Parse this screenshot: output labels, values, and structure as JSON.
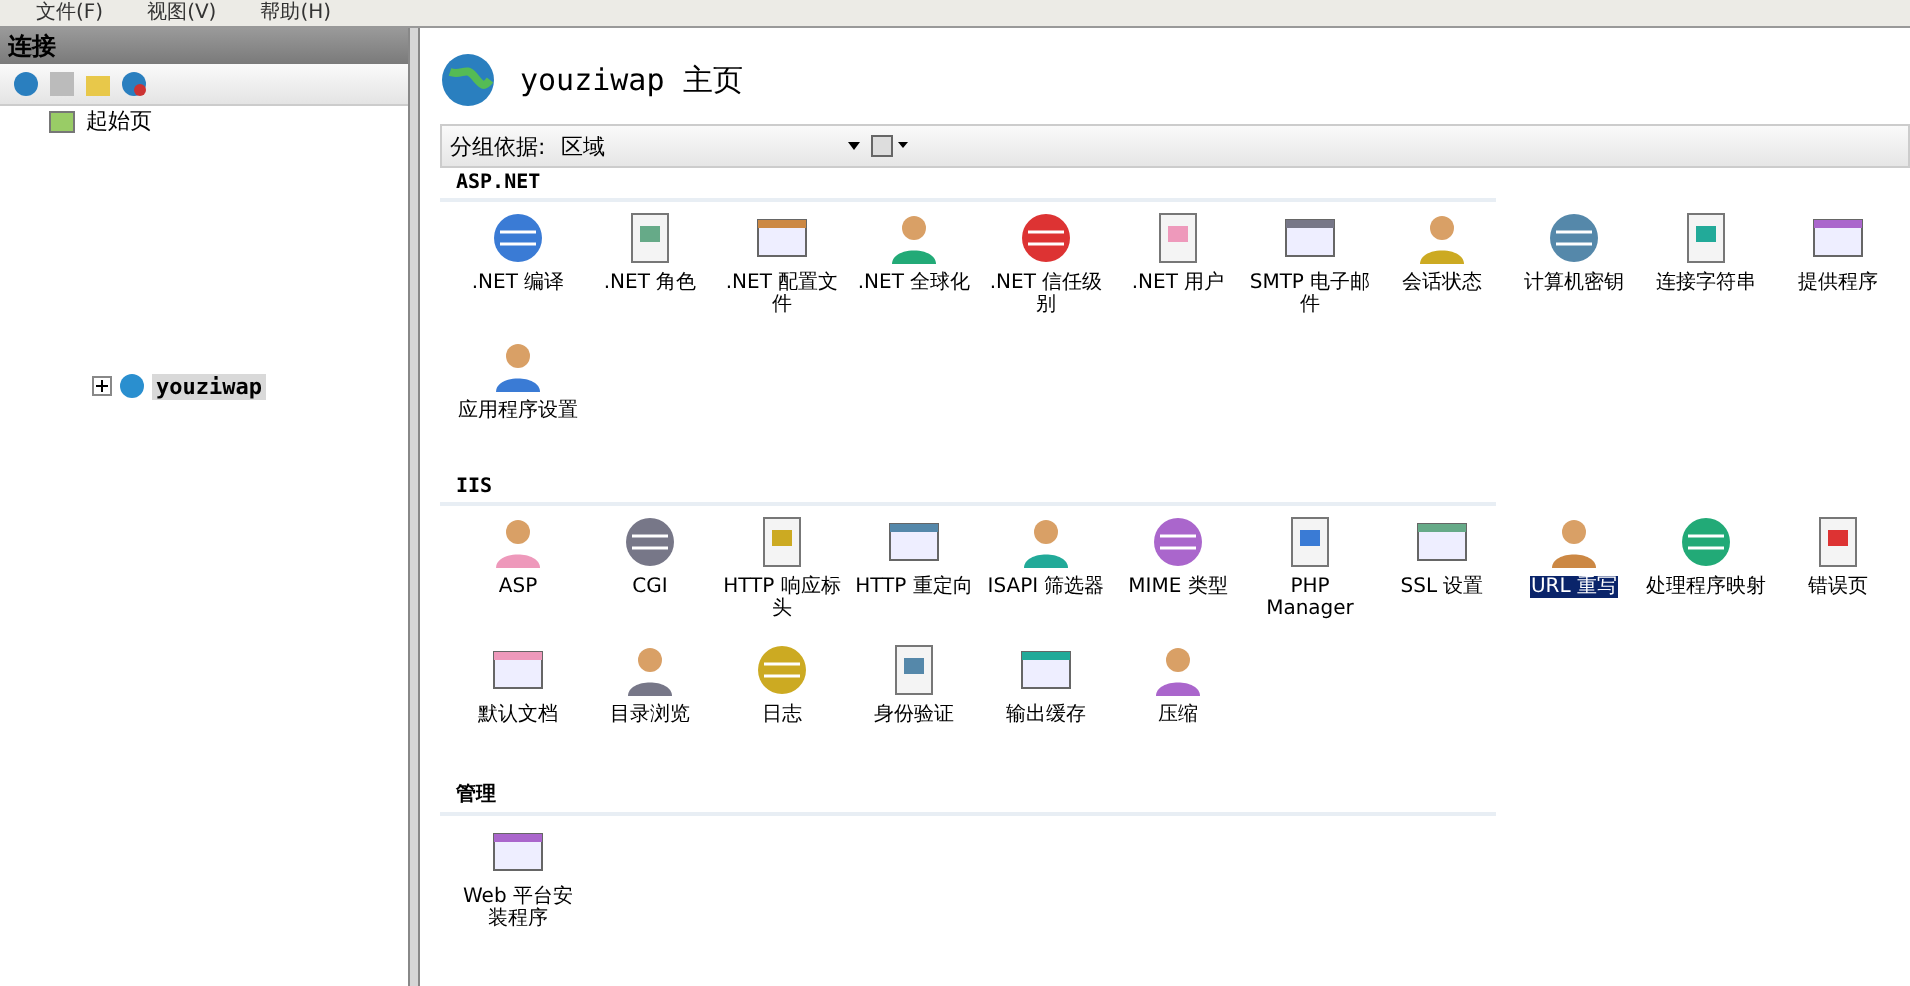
{
  "menu": [
    "文件(F)",
    "视图(V)",
    "帮助(H)"
  ],
  "connections": {
    "title": "连接",
    "tree": [
      {
        "label": "起始页",
        "kind": "page",
        "selected": false
      },
      {
        "label": "youziwap",
        "kind": "server",
        "selected": true,
        "expanded": false
      }
    ]
  },
  "home": {
    "title": "youziwap 主页",
    "group_by": {
      "label": "分组依据:",
      "value": "区域"
    },
    "sections": [
      {
        "title": "ASP.NET",
        "items": [
          {
            "label": ".NET 编译",
            "selected": false
          },
          {
            "label": ".NET 角色",
            "selected": false
          },
          {
            "label": ".NET 配置文件",
            "selected": false
          },
          {
            "label": ".NET 全球化",
            "selected": false
          },
          {
            "label": ".NET 信任级别",
            "selected": false
          },
          {
            "label": ".NET 用户",
            "selected": false
          },
          {
            "label": "SMTP 电子邮件",
            "selected": false
          },
          {
            "label": "会话状态",
            "selected": false
          },
          {
            "label": "计算机密钥",
            "selected": false
          },
          {
            "label": "连接字符串",
            "selected": false
          },
          {
            "label": "提供程序",
            "selected": false
          },
          {
            "label": "应用程序设置",
            "selected": false
          }
        ]
      },
      {
        "title": "IIS",
        "items": [
          {
            "label": "ASP",
            "selected": false
          },
          {
            "label": "CGI",
            "selected": false
          },
          {
            "label": "HTTP 响应标头",
            "selected": false
          },
          {
            "label": "HTTP 重定向",
            "selected": false
          },
          {
            "label": "ISAPI 筛选器",
            "selected": false
          },
          {
            "label": "MIME 类型",
            "selected": false
          },
          {
            "label": "PHP Manager",
            "selected": false
          },
          {
            "label": "SSL 设置",
            "selected": false
          },
          {
            "label": "URL 重写",
            "selected": true
          },
          {
            "label": "处理程序映射",
            "selected": false
          },
          {
            "label": "错误页",
            "selected": false
          },
          {
            "label": "默认文档",
            "selected": false
          },
          {
            "label": "目录浏览",
            "selected": false
          },
          {
            "label": "日志",
            "selected": false
          },
          {
            "label": "身份验证",
            "selected": false
          },
          {
            "label": "输出缓存",
            "selected": false
          },
          {
            "label": "压缩",
            "selected": false
          }
        ]
      },
      {
        "title": "管理",
        "items": [
          {
            "label": "Web 平台安装程序",
            "selected": false
          }
        ]
      }
    ]
  }
}
